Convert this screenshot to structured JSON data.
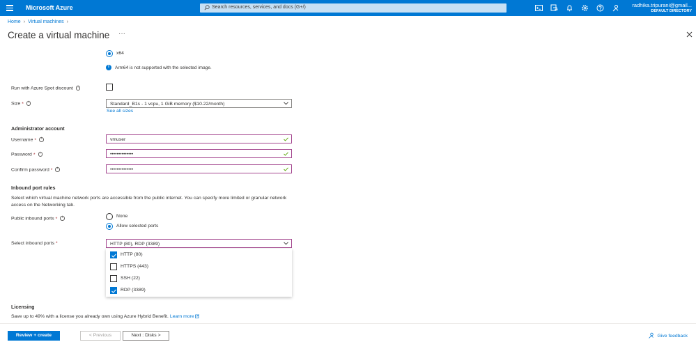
{
  "topbar": {
    "brand": "Microsoft Azure",
    "search_placeholder": "Search resources, services, and docs (G+/)",
    "user_name": "radhika.tripurani@gmail...",
    "user_directory": "DEFAULT DIRECTORY"
  },
  "breadcrumb": {
    "home": "Home",
    "virtual_machines": "Virtual machines"
  },
  "page": {
    "title": "Create a virtual machine",
    "more": "···"
  },
  "architecture": {
    "option_x64": "x64",
    "arm_note": "Arm64 is not supported with the selected image."
  },
  "spot": {
    "label": "Run with Azure Spot discount",
    "checked": false
  },
  "size": {
    "label": "Size",
    "required": "*",
    "value": "Standard_B1s - 1 vcpu, 1 GiB memory ($10.22/month)",
    "see_all": "See all sizes"
  },
  "admin": {
    "heading": "Administrator account",
    "username_label": "Username",
    "username_value": "vmuser",
    "password_label": "Password",
    "password_value": "••••••••••••••",
    "confirm_label": "Confirm password",
    "confirm_value": "••••••••••••••",
    "required": "*"
  },
  "inbound": {
    "heading": "Inbound port rules",
    "description": "Select which virtual machine network ports are accessible from the public internet. You can specify more limited or granular network access on the Networking tab.",
    "public_label": "Public inbound ports",
    "option_none": "None",
    "option_allow": "Allow selected ports",
    "selected": "Allow selected ports",
    "select_label": "Select inbound ports",
    "select_value": "HTTP (80), RDP (3389)",
    "required": "*",
    "options": [
      {
        "label": "HTTP (80)",
        "checked": true
      },
      {
        "label": "HTTPS (443)",
        "checked": false
      },
      {
        "label": "SSH (22)",
        "checked": false
      },
      {
        "label": "RDP (3389)",
        "checked": true
      }
    ]
  },
  "licensing": {
    "heading": "Licensing",
    "text": "Save up to 49% with a license you already own using Azure Hybrid Benefit.",
    "learn_more": "Learn more"
  },
  "footer": {
    "review_create": "Review + create",
    "previous": "< Previous",
    "next": "Next : Disks >",
    "feedback": "Give feedback"
  },
  "colors": {
    "azure_blue": "#0078d4",
    "validated_border": "#a4478f",
    "valid_check": "#57a300"
  }
}
